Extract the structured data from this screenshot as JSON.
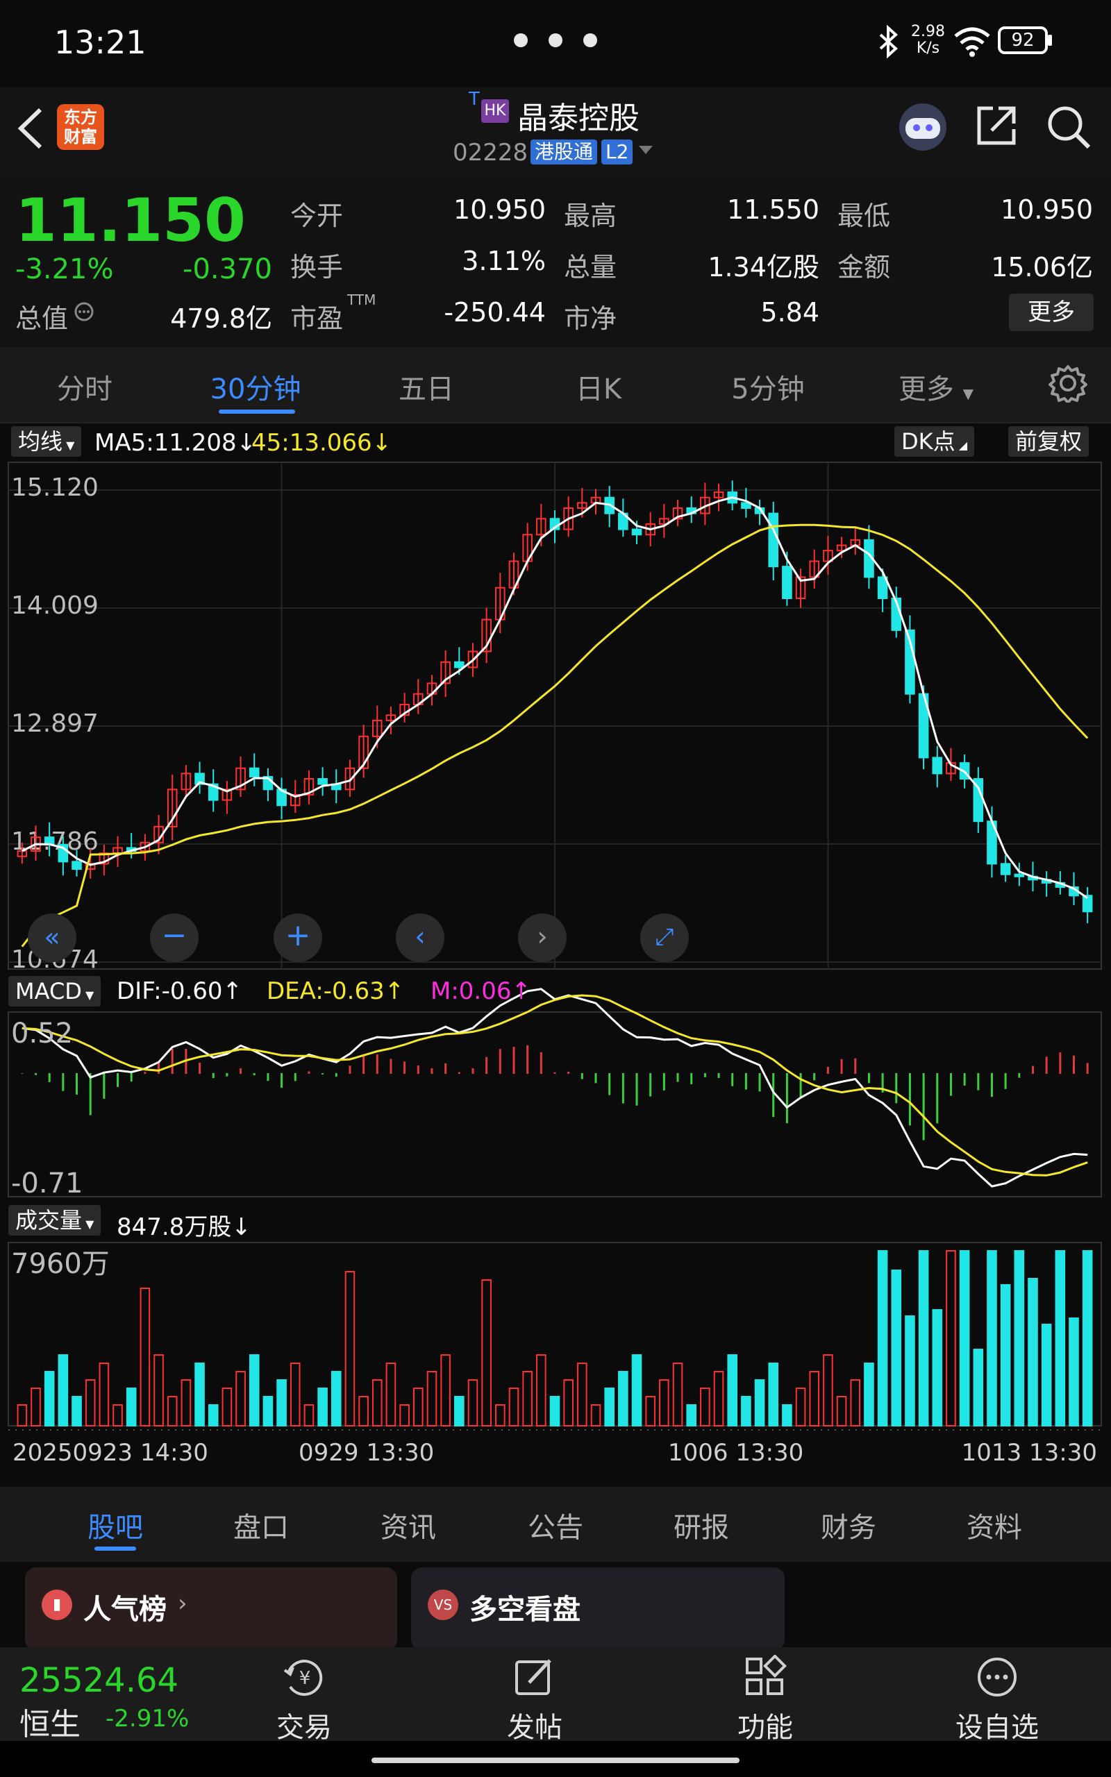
{
  "status_bar": {
    "time": "13:21",
    "net_speed_value": "2.98",
    "net_speed_unit": "K/s",
    "battery": "92"
  },
  "header": {
    "title": "晶泰控股",
    "market_badge": "HK",
    "code": "02228",
    "connect_tag": "港股通",
    "level_tag": "L2",
    "logo_line1": "东方",
    "logo_line2": "财富"
  },
  "quote": {
    "price": "11.150",
    "change_pct": "-3.21%",
    "change": "-0.370",
    "market_cap_label": "总值",
    "market_cap": "479.8亿",
    "open_label": "今开",
    "open": "10.950",
    "high_label": "最高",
    "high": "11.550",
    "low_label": "最低",
    "low": "10.950",
    "turnover_label": "换手",
    "turnover": "3.11%",
    "volume_label": "总量",
    "volume": "1.34亿股",
    "amount_label": "金额",
    "amount": "15.06亿",
    "pe_label": "市盈",
    "pe_sup": "TTM",
    "pe": "-250.44",
    "pb_label": "市净",
    "pb": "5.84",
    "more_label": "更多"
  },
  "tabs": [
    "分时",
    "30分钟",
    "五日",
    "日K",
    "5分钟",
    "更多"
  ],
  "indicators": {
    "ma_chip": "均线",
    "ma5": "MA5:11.208↓",
    "ma45": "45:13.066↓",
    "dk_chip": "DK点",
    "fq_chip": "前复权",
    "macd_chip": "MACD",
    "dif": "DIF:-0.60↑",
    "dea": "DEA:-0.63↑",
    "m": "M:0.06↑",
    "vol_chip": "成交量",
    "vol_value": "847.8万股↓"
  },
  "chart_data": {
    "type": "candlestick",
    "price_axis_labels": [
      "15.120",
      "14.009",
      "12.897",
      "11.786",
      "10.674"
    ],
    "price_range": [
      10.674,
      15.12
    ],
    "close_series": [
      11.72,
      11.85,
      11.78,
      11.62,
      11.55,
      11.6,
      11.7,
      11.75,
      11.72,
      11.8,
      11.95,
      12.3,
      12.45,
      12.35,
      12.2,
      12.3,
      12.5,
      12.42,
      12.3,
      12.15,
      12.25,
      12.4,
      12.35,
      12.3,
      12.5,
      12.8,
      12.95,
      13.0,
      13.1,
      13.2,
      13.3,
      13.5,
      13.45,
      13.6,
      13.9,
      14.2,
      14.45,
      14.7,
      14.85,
      14.75,
      14.95,
      15.0,
      15.05,
      14.9,
      14.75,
      14.7,
      14.8,
      14.85,
      14.95,
      14.9,
      15.05,
      15.1,
      15.0,
      14.95,
      14.9,
      14.4,
      14.1,
      14.3,
      14.45,
      14.55,
      14.6,
      14.65,
      14.3,
      14.1,
      13.8,
      13.2,
      12.6,
      12.45,
      12.55,
      12.4,
      12.0,
      11.6,
      11.5,
      11.48,
      11.45,
      11.42,
      11.38,
      11.3,
      11.15
    ],
    "macd_axis_labels": [
      "0.52",
      "-0.71"
    ],
    "volume_axis_label": "7960万",
    "x_labels": [
      "20250923 14:30",
      "0929 13:30",
      "1006 13:30",
      "1013 13:30"
    ]
  },
  "bottom_tabs": [
    "股吧",
    "盘口",
    "资讯",
    "公告",
    "研报",
    "财务",
    "资料"
  ],
  "cards": {
    "hot_title": "人气榜",
    "hot_icon": "chart-icon",
    "longshort_title": "多空看盘",
    "longshort_icon": "VS"
  },
  "bottom_nav": {
    "index_value": "25524.64",
    "index_name": "恒生",
    "index_change": "-2.91%",
    "trade": "交易",
    "post": "发帖",
    "functions": "功能",
    "watchlist": "设自选"
  }
}
